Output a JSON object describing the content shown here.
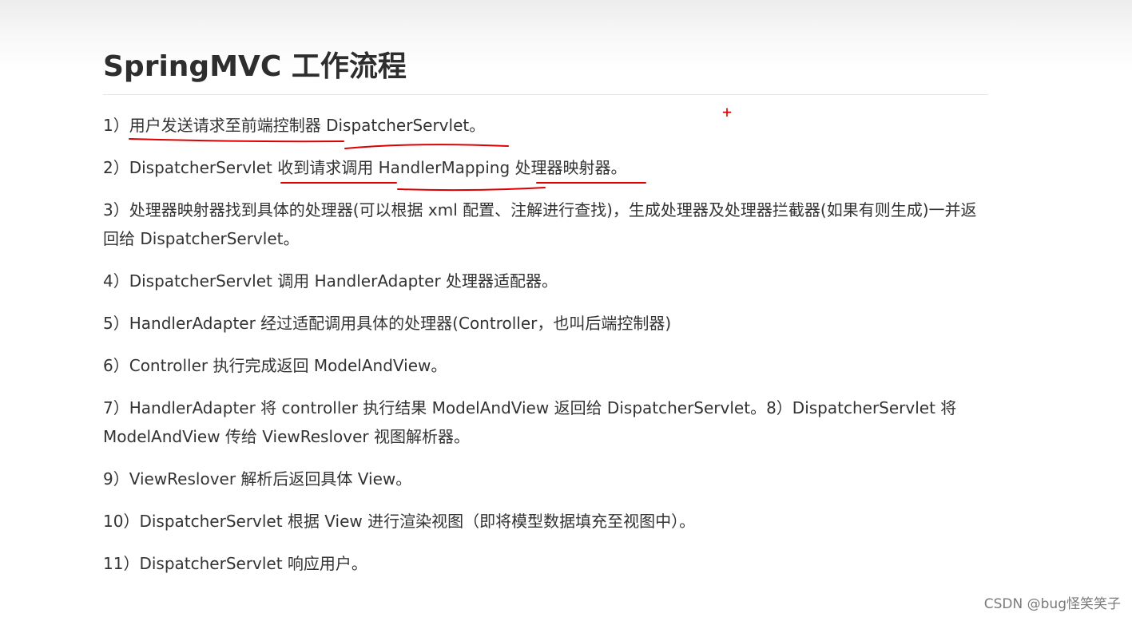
{
  "article": {
    "title": "SpringMVC 工作流程",
    "steps": [
      "1）用户发送请求至前端控制器 DispatcherServlet。",
      "2）DispatcherServlet 收到请求调用 HandlerMapping 处理器映射器。",
      "3）处理器映射器找到具体的处理器(可以根据 xml 配置、注解进行查找)，生成处理器及处理器拦截器(如果有则生成)一并返回给 DispatcherServlet。",
      "4）DispatcherServlet 调用 HandlerAdapter 处理器适配器。",
      "5）HandlerAdapter 经过适配调用具体的处理器(Controller，也叫后端控制器)",
      "6）Controller 执行完成返回 ModelAndView。",
      "7）HandlerAdapter 将 controller 执行结果 ModelAndView 返回给 DispatcherServlet。8）DispatcherServlet 将 ModelAndView 传给 ViewReslover 视图解析器。",
      "9）ViewReslover 解析后返回具体 View。",
      "10）DispatcherServlet 根据 View 进行渲染视图（即将模型数据填充至视图中）。",
      "11）DispatcherServlet 响应用户。"
    ]
  },
  "cursor": {
    "glyph": "+"
  },
  "annotation_color": "#dd0000",
  "watermark": "CSDN @bug怪笑笑子"
}
